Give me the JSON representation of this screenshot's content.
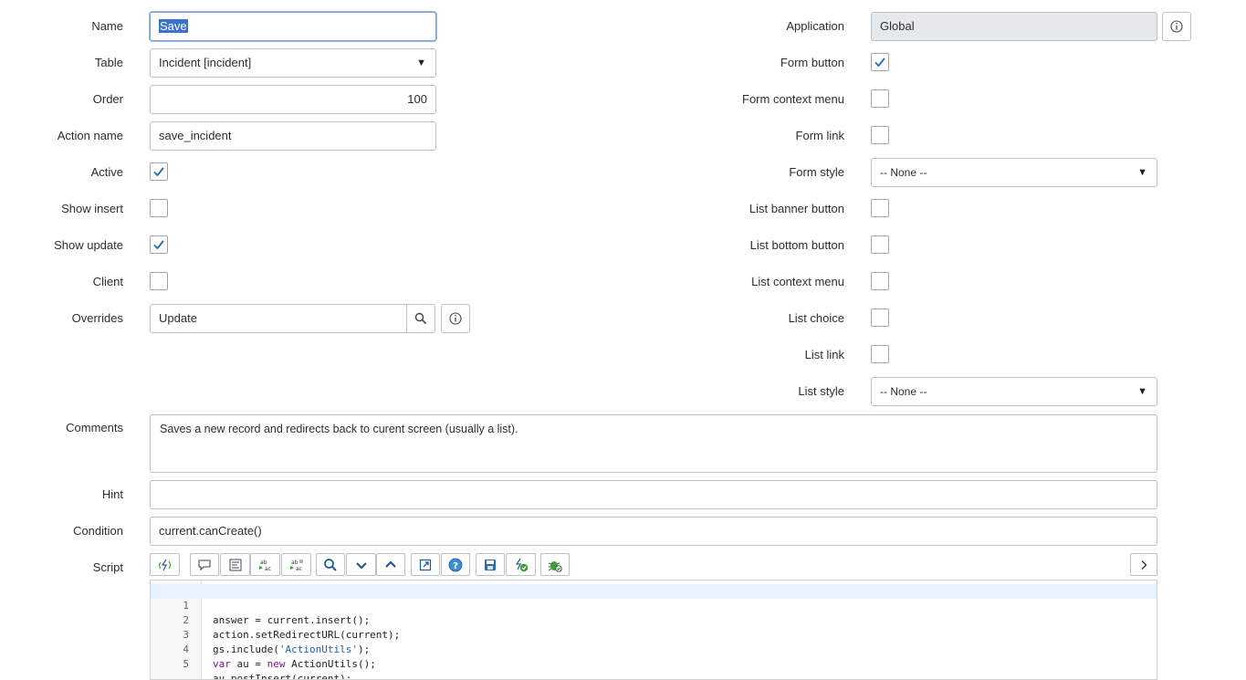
{
  "form": {
    "left": {
      "name": {
        "label": "Name",
        "value_selected": "Save"
      },
      "table": {
        "label": "Table",
        "value": "Incident [incident]"
      },
      "order": {
        "label": "Order",
        "value": "100"
      },
      "action_name": {
        "label": "Action name",
        "value": "save_incident"
      },
      "active": {
        "label": "Active",
        "checked": true
      },
      "show_insert": {
        "label": "Show insert",
        "checked": false
      },
      "show_update": {
        "label": "Show update",
        "checked": true
      },
      "client": {
        "label": "Client",
        "checked": false
      },
      "overrides": {
        "label": "Overrides",
        "value": "Update"
      }
    },
    "right": {
      "application": {
        "label": "Application",
        "value": "Global"
      },
      "form_button": {
        "label": "Form button",
        "checked": true
      },
      "form_context_menu": {
        "label": "Form context menu",
        "checked": false
      },
      "form_link": {
        "label": "Form link",
        "checked": false
      },
      "form_style": {
        "label": "Form style",
        "value": "-- None --"
      },
      "list_banner_button": {
        "label": "List banner button",
        "checked": false
      },
      "list_bottom_button": {
        "label": "List bottom button",
        "checked": false
      },
      "list_context_menu": {
        "label": "List context menu",
        "checked": false
      },
      "list_choice": {
        "label": "List choice",
        "checked": false
      },
      "list_link": {
        "label": "List link",
        "checked": false
      },
      "list_style": {
        "label": "List style",
        "value": "-- None --"
      }
    },
    "comments": {
      "label": "Comments",
      "value": "Saves a new record and redirects back to curent screen (usually a list)."
    },
    "hint": {
      "label": "Hint",
      "value": ""
    },
    "condition": {
      "label": "Condition",
      "value": "current.canCreate()"
    },
    "script": {
      "label": "Script",
      "toolbar": [
        "toggle-syntax-icon",
        "comment-icon",
        "format-icon",
        "replace-icon",
        "replace-all-icon",
        "search-icon",
        "collapse-down-icon",
        "collapse-up-icon",
        "fullscreen-icon",
        "help-icon",
        "save-icon",
        "check-syntax-icon",
        "debug-icon"
      ],
      "line_numbers": [
        "1",
        "2",
        "3",
        "4",
        "5"
      ],
      "lines": [
        {
          "plain": "answer = current.insert();"
        },
        {
          "plain": "action.setRedirectURL(current);"
        },
        {
          "pre": "gs.include(",
          "str": "'ActionUtils'",
          "post": ");"
        },
        {
          "kw1": "var",
          "mid": " au = ",
          "kw2": "new",
          "post": " ActionUtils();"
        },
        {
          "plain": "au.postInsert(current);"
        }
      ]
    }
  },
  "colors": {
    "accent_check": "#1f6fbf",
    "selection": "#3a73c9",
    "focus_border": "#7aa2d6"
  }
}
